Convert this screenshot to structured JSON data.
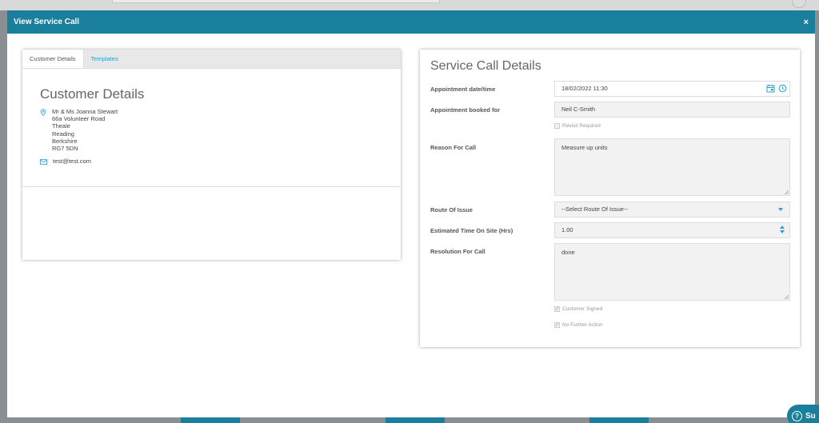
{
  "modal": {
    "title": "View Service Call",
    "close_glyph": "×"
  },
  "tabs": [
    {
      "label": "Customer Details",
      "active": true
    },
    {
      "label": "Templates",
      "active": false
    }
  ],
  "customer": {
    "heading": "Customer Details",
    "address_lines": [
      "Mr & Ms Joanna Stewart",
      "66a Volunteer Road",
      "Theale",
      "Reading",
      "Berkshire",
      "RG7 5DN"
    ],
    "email": "test@test.com",
    "address_icon": "map-pin-icon",
    "email_icon": "envelope-icon"
  },
  "service_call": {
    "heading": "Service Call Details",
    "appointment_label": "Appointment date/time",
    "appointment_value": "18/02/2022 11:30",
    "booked_for_label": "Appointment booked for",
    "booked_for_value": "Neil C-Smith",
    "revisit_label": "Revisit Required",
    "revisit_checked": false,
    "reason_label": "Reason For Call",
    "reason_value": "Measure up units",
    "route_label": "Route Of Issue",
    "route_value": "--Select Route Of Issue--",
    "est_time_label": "Estimated Time On Site (Hrs)",
    "est_time_value": "1.00",
    "resolution_label": "Resolution For Call",
    "resolution_value": "done",
    "customer_signed_label": "Customer Signed",
    "customer_signed_checked": true,
    "no_further_label": "No Further Action",
    "no_further_checked": true
  },
  "support": {
    "label": "Su"
  },
  "colors": {
    "header": "#1a7f9c",
    "link": "#2a9fd0"
  }
}
